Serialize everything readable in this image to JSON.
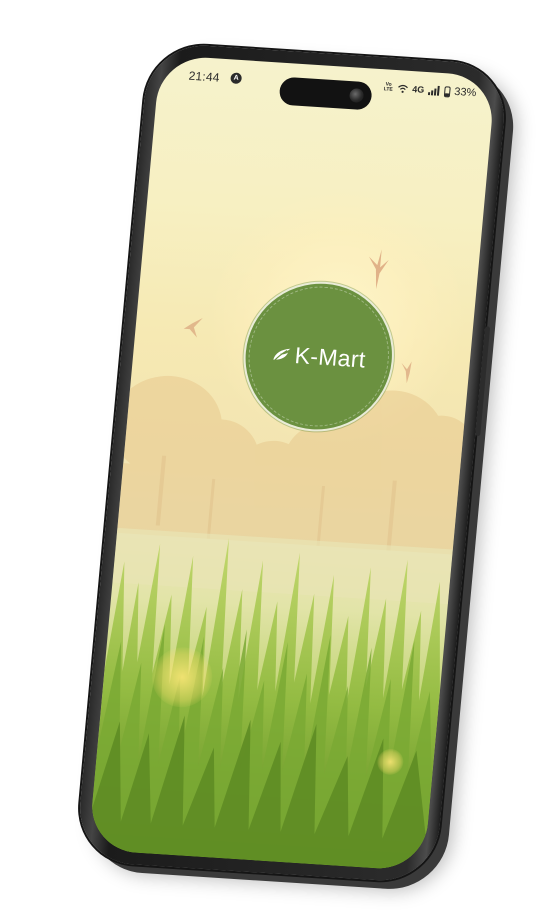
{
  "status_bar": {
    "time": "21:44",
    "app_icon": "A",
    "volte": "Vo LTE",
    "network": "4G",
    "battery": "33%",
    "icons": [
      "wifi-calling-icon",
      "signal-icon",
      "battery-icon"
    ]
  },
  "splash": {
    "brand_name": "K-Mart",
    "logo_icon": "leaf-logo-icon",
    "logo_color": "#6b9140"
  },
  "background": {
    "sky_color": "#f6f2cc",
    "grass_color": "#6f9e2e"
  }
}
